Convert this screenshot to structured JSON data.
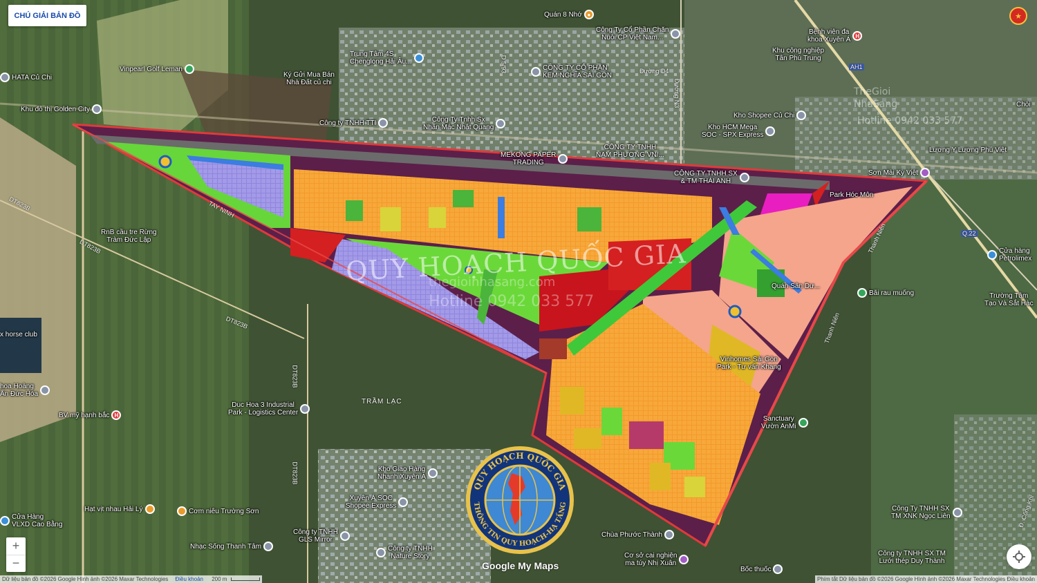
{
  "legend_button": "CHÚ GIẢI BẢN ĐỒ",
  "watermark": {
    "main": "QUY HOẠCH QUỐC GIA",
    "site": "thegioinhasang.com",
    "hotline": "Hotline 0942 033 577",
    "corner_brand": "TheGioi NhaSang",
    "corner_hotline": "Hotline 0942 033 577"
  },
  "seal": {
    "top_text": "QUY HOẠCH QUỐC GIA",
    "bottom_text": "THÔNG TIN QUY HOẠCH-HẠ TẦNG"
  },
  "google_brand": "Google My Maps",
  "attribution_left": "Dữ liệu bản đồ ©2026 Google Hình ảnh ©2026 Maxar Technologies",
  "terms_left": "Điều khoản",
  "scale": "200 m",
  "attribution_right": "Phím tắt   Dữ liệu bản đồ ©2026 Google Hình ảnh ©2026 Maxar Technologies   Điều khoản",
  "zoom": {
    "in": "+",
    "out": "−"
  },
  "roads": {
    "tay_ninh": "TAY NINH",
    "dt823b_1": "DT823B",
    "dt823b_2": "DT823B",
    "dt823b_3": "DT823B",
    "dt823b_4": "DT823B",
    "dt823b_5": "DT823B",
    "thanh_nien_1": "Thanh Niên",
    "thanh_nien_2": "Thanh Niên",
    "duong_n3": "Đường N3",
    "duong_d4": "Đường D4",
    "d5_93": "D 5/93",
    "ah1": "AH1",
    "q22": "Q.22",
    "tram_lac": "TRẦM LẠC",
    "cong_khi": "Đ. Cống Khí"
  },
  "pois": {
    "quan8": "Quán 8 Nhớ",
    "cp_chan_nuoi_1": "Công Ty Cổ Phần Chăn",
    "cp_chan_nuoi_2": "Nuôi CP Việt Nam...",
    "trung_tam_4s_1": "Trung Tâm 4S",
    "trung_tam_4s_2": "Chenglong Hải Âu...",
    "vinpearl": "Vinpearl Golf Leman",
    "hata": "HATA Củ Chi",
    "ky_gui_1": "Ký Gửi Mua Bán",
    "ky_gui_2": "Nhà Đất củ chi",
    "golden_city": "Khu đô thị Golden City",
    "kem_nghia_1": "CÔNG TY CỔ PHẦN",
    "kem_nghia_2": "KEM NGHĨA SÀI GÒN",
    "tti": "Công ty TNHH TTI",
    "nhan_mac_1": "Công Ty Tnhh Sx",
    "nhan_mac_2": "Nhãn Mác Nhật Quang",
    "mekong_1": "MEKONG PAPER",
    "mekong_2": "TRADING",
    "nam_phuong_1": "CÔNG TY TNHH",
    "nam_phuong_2": "NAM PHƯƠNG VN/...",
    "thai_anh_1": "CÔNG TY TNHH SX",
    "thai_anh_2": "& TM THÁI ANH",
    "shopee_cu_chi": "Kho Shopee Củ Chi",
    "kho_hcm_1": "Kho HCM Mega",
    "kho_hcm_2": "SOC - SPX Express",
    "benh_vien_1": "Bệnh viện đa",
    "benh_vien_2": "khoa Xuyên Á",
    "kcn_tan_phu_1": "Khu công nghiệp",
    "kcn_tan_phu_2": "Tân Phú Trung",
    "luong_y": "Lương Y Lương Phú Việt",
    "son_mai": "Sơn Mài Kỳ Việt",
    "park_hoc_mon": "Park Hóc Môn",
    "cua_hang_1": "Cửa hàng",
    "cua_hang_2": "Petrolimex",
    "tram_tang_1": "Trường Tâm",
    "tram_tang_2": "Tạo Và Sắt Hàc",
    "bai_rau": "Bãi rau muống",
    "chom": "Chòi",
    "rnb_1": "RnB cầu tre Rừng",
    "rnb_2": "Tràm Đức Lập",
    "horse_club": "x horse club",
    "hoa_hoang_1": "hoa Hoàng",
    "hoa_hoang_2": "Ấn Đức Hòa",
    "bv_my_hanh": "BV mỹ hạnh bắc",
    "duc_hoa_1": "Duc Hoa 3 Industrial",
    "duc_hoa_2": "Park - Logistics Center",
    "vinhomes_1": "Vinhomes Sài Gòn",
    "vinhomes_2": "Park - Tư vấn Khang",
    "quan_sat": "Quán Sân Dư...",
    "sanctuary_1": "Sanctuary",
    "sanctuary_2": "Vườn AnMi",
    "kho_giao_1": "Kho Giao Hàng",
    "kho_giao_2": "Nhanh Xuyên Á",
    "xuyen_a_1": "Xuyên Á SOC",
    "xuyen_a_2": "Shopee Express",
    "hat_voi": "Hạt vịt nhau Hải Lý",
    "com_nieu": "Cơm niêu Trường Sơn",
    "cua_hang_vlxd_1": "Cửa Hàng",
    "cua_hang_vlxd_2": "VLXD Cao Bằng",
    "gls_1": "Công ty TNHH",
    "gls_2": "GLS Mirror",
    "nhac_song": "Nhạc Sống Thanh Tâm",
    "nature_1": "Công ty TNHH",
    "nature_2": "Nature Story",
    "chua_phuoc": "Chùa Phước Thành",
    "co_so_1": "Cơ sở cai nghiện",
    "co_so_2": "ma túy Nhị Xuân",
    "boc_thuoc": "Bốc thuốc",
    "ngoc_lien_1": "Công Ty TNHH SX",
    "ngoc_lien_2": "TM XNK Ngọc Liên",
    "duy_thanh_1": "Công ty TNHH SX TM",
    "duy_thanh_2": "Lưới thép Duy Thành"
  }
}
